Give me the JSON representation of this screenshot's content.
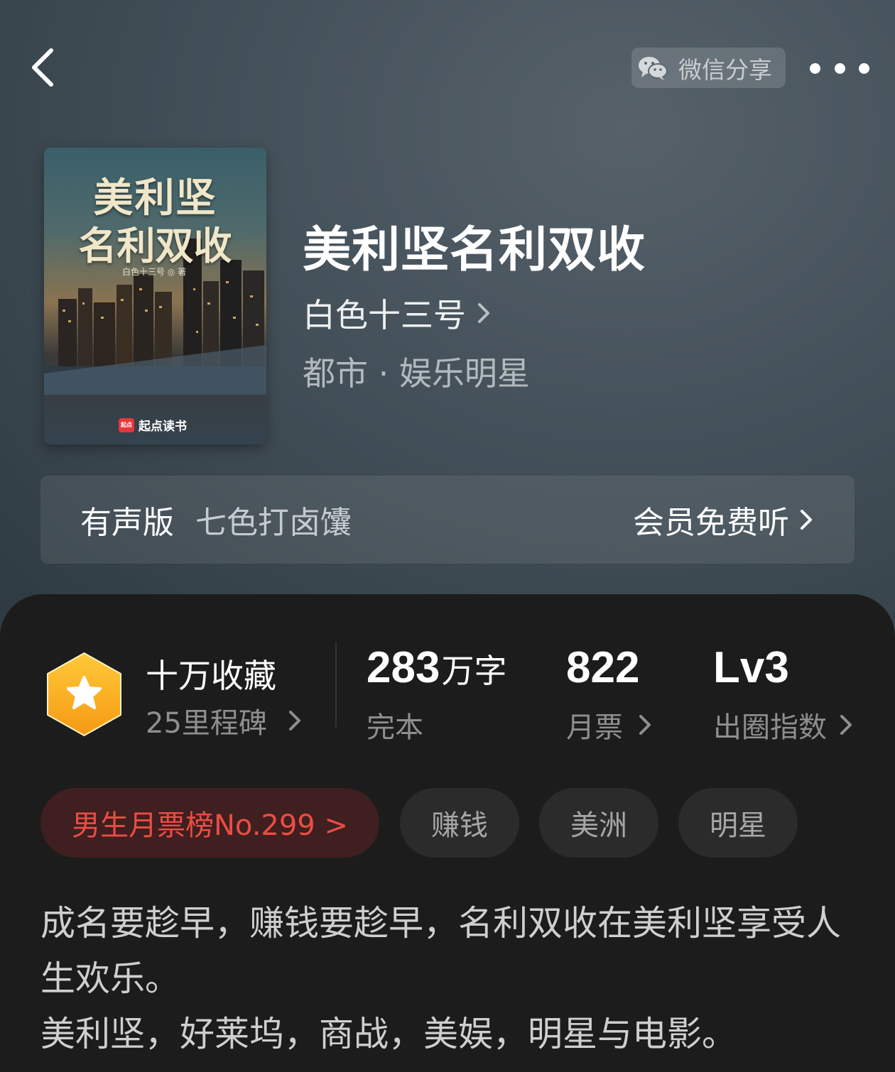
{
  "header": {
    "back_icon": "chevron-left-icon",
    "share_label": "微信分享",
    "share_icon": "wechat-icon",
    "more_icon": "more-dots-icon"
  },
  "book": {
    "cover": {
      "title_line1": "美利坚",
      "title_line2": "名利双收",
      "author_line": "白色十三号 ◎ 著",
      "brand": "起点读书",
      "brand_logo_text": "起点"
    },
    "title": "美利坚名利双收",
    "author": "白色十三号",
    "genre": "都市 · 娱乐明星"
  },
  "audio": {
    "label": "有声版",
    "narrator": "七色打卤馕",
    "link": "会员免费听"
  },
  "stats": {
    "collection_title": "十万收藏",
    "collection_sub": "25里程碑",
    "word_count": "283",
    "word_unit": "万字",
    "word_sub": "完本",
    "monthly_tickets": "822",
    "monthly_tickets_label": "月票",
    "circle_index": "Lv3",
    "circle_index_label": "出圈指数"
  },
  "tags": {
    "rank": "男生月票榜No.299 >",
    "items": [
      "赚钱",
      "美洲",
      "明星"
    ]
  },
  "description": {
    "line1": "成名要趁早，赚钱要趁早，名利双收在美利坚享受人生欢乐。",
    "line2": "美利坚，好莱坞，商战，美娱，明星与电影。"
  },
  "colors": {
    "accent_red": "#ea4d45",
    "badge_gold": "#f6ad1e",
    "panel_bg": "#1c1c1c"
  }
}
